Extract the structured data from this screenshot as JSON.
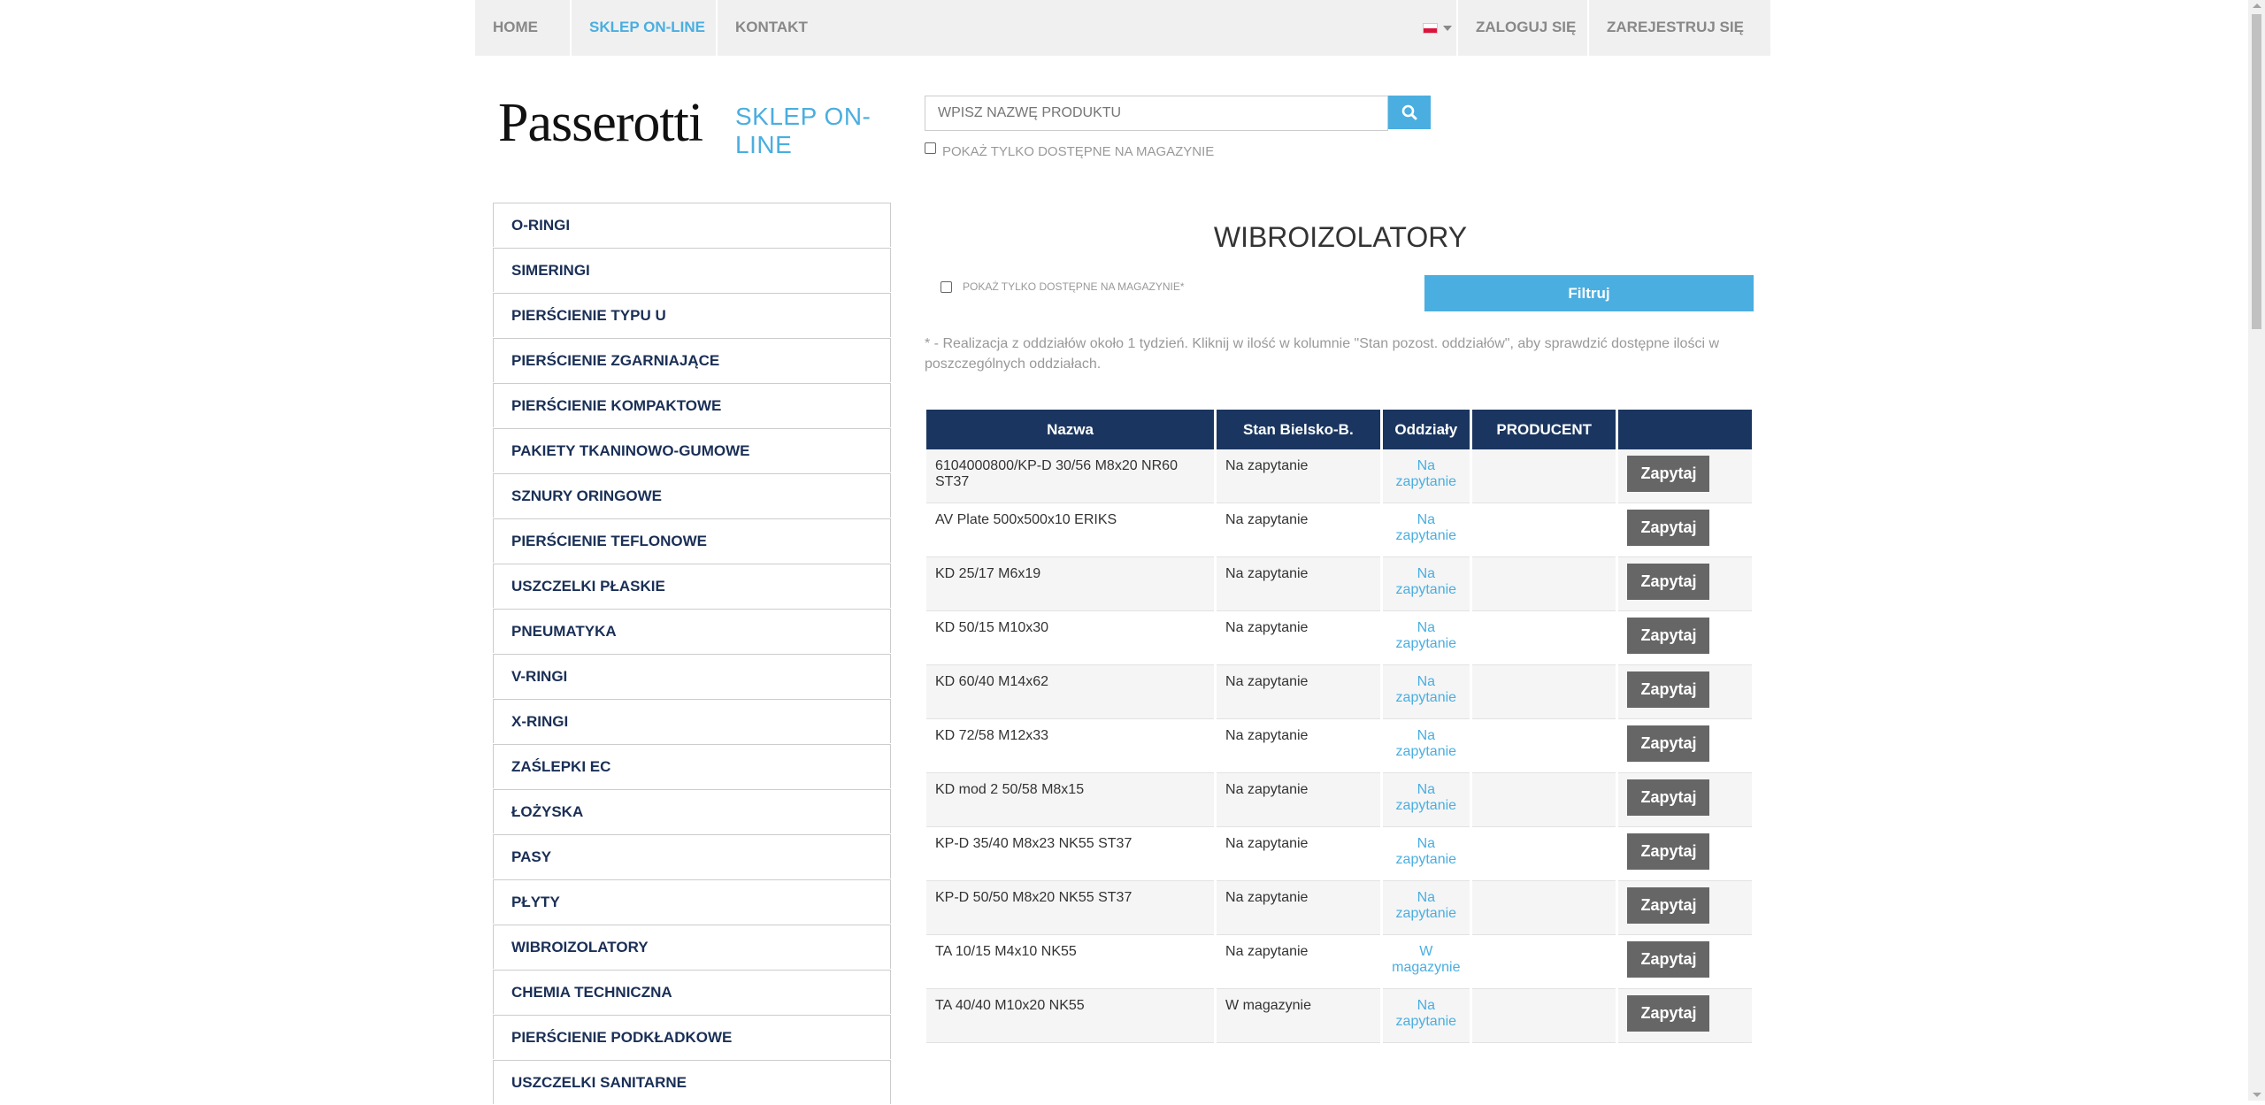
{
  "nav": {
    "home": "HOME",
    "shop": "SKLEP ON-LINE",
    "contact": "KONTAKT",
    "login": "ZALOGUJ SIĘ",
    "register": "ZAREJESTRUJ SIĘ",
    "language_icon": "poland-flag-icon"
  },
  "logo": {
    "brand": "Passerotti",
    "shop": "SKLEP ON-LINE"
  },
  "search": {
    "placeholder": "WPISZ NAZWĘ PRODUKTU",
    "icon": "search-icon",
    "stock_only_label": "POKAŻ TYLKO DOSTĘPNE NA MAGAZYNIE"
  },
  "sidebar": {
    "items": [
      "O-RINGI",
      "SIMERINGI",
      "PIERŚCIENIE TYPU U",
      "PIERŚCIENIE ZGARNIAJĄCE",
      "PIERŚCIENIE KOMPAKTOWE",
      "PAKIETY TKANINOWO-GUMOWE",
      "SZNURY ORINGOWE",
      "PIERŚCIENIE TEFLONOWE",
      "USZCZELKI PŁASKIE",
      "PNEUMATYKA",
      "V-RINGI",
      "X-RINGI",
      "ZAŚLEPKI EC",
      "ŁOŻYSKA",
      "PASY",
      "PŁYTY",
      "WIBROIZOLATORY",
      "CHEMIA TECHNICZNA",
      "PIERŚCIENIE PODKŁADKOWE",
      "USZCZELKI SANITARNE"
    ]
  },
  "main": {
    "title": "WIBROIZOLATORY",
    "filter_checkbox_label": "POKAŻ TYLKO DOSTĘPNE NA MAGAZYNIE*",
    "filter_button": "Filtruj",
    "note": "* - Realizacja z oddziałów około 1 tydzień. Kliknij w ilość w kolumnie \"Stan pozost. oddziałów\", aby sprawdzić dostępne ilości w poszczególnych oddziałach."
  },
  "table": {
    "headers": [
      "Nazwa",
      "Stan Bielsko-B.",
      "Oddziały",
      "PRODUCENT",
      ""
    ],
    "rows": [
      {
        "name": "6104000800/KP-D 30/56 M8x20 NR60 ST37",
        "stock": "Na zapytanie",
        "branches": "Na zapytanie",
        "producer": "",
        "action": "Zapytaj"
      },
      {
        "name": "AV Plate 500x500x10 ERIKS",
        "stock": "Na zapytanie",
        "branches": "Na zapytanie",
        "producer": "",
        "action": "Zapytaj"
      },
      {
        "name": "KD 25/17 M6x19",
        "stock": "Na zapytanie",
        "branches": "Na zapytanie",
        "producer": "",
        "action": "Zapytaj"
      },
      {
        "name": "KD 50/15 M10x30",
        "stock": "Na zapytanie",
        "branches": "Na zapytanie",
        "producer": "",
        "action": "Zapytaj"
      },
      {
        "name": "KD 60/40 M14x62",
        "stock": "Na zapytanie",
        "branches": "Na zapytanie",
        "producer": "",
        "action": "Zapytaj"
      },
      {
        "name": "KD 72/58 M12x33",
        "stock": "Na zapytanie",
        "branches": "Na zapytanie",
        "producer": "",
        "action": "Zapytaj"
      },
      {
        "name": "KD mod 2 50/58 M8x15",
        "stock": "Na zapytanie",
        "branches": "Na zapytanie",
        "producer": "",
        "action": "Zapytaj"
      },
      {
        "name": "KP-D 35/40 M8x23 NK55 ST37",
        "stock": "Na zapytanie",
        "branches": "Na zapytanie",
        "producer": "",
        "action": "Zapytaj"
      },
      {
        "name": "KP-D 50/50 M8x20 NK55 ST37",
        "stock": "Na zapytanie",
        "branches": "Na zapytanie",
        "producer": "",
        "action": "Zapytaj"
      },
      {
        "name": "TA 10/15 M4x10 NK55",
        "stock": "Na zapytanie",
        "branches": "W magazynie",
        "producer": "",
        "action": "Zapytaj"
      },
      {
        "name": "TA 40/40 M10x20 NK55",
        "stock": "W magazynie",
        "branches": "Na zapytanie",
        "producer": "",
        "action": "Zapytaj"
      }
    ]
  },
  "colors": {
    "accent": "#4aaee0",
    "header": "#1a3660",
    "nav_bg": "#f0f0f0",
    "button_gray": "#666666"
  }
}
